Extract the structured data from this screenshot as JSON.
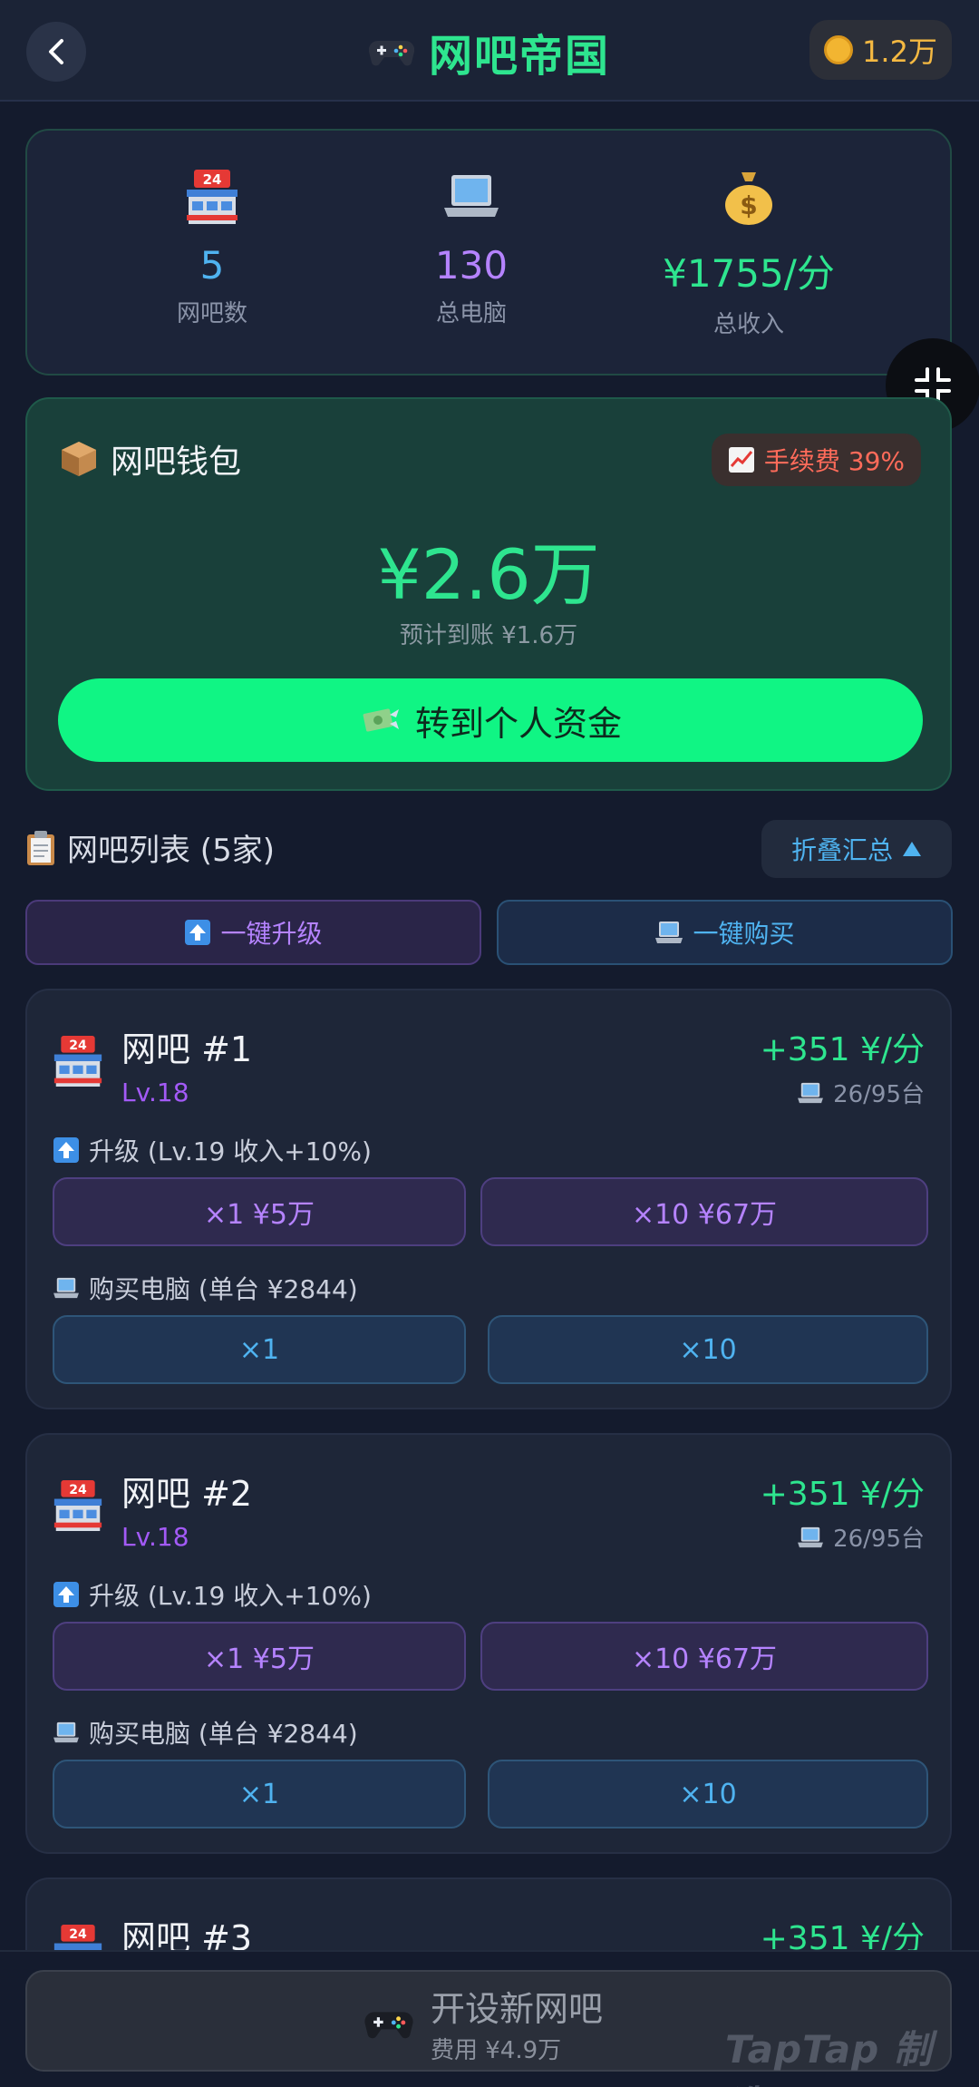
{
  "header": {
    "title": "网吧帝国",
    "coins": "1.2万"
  },
  "stats": [
    {
      "value": "5",
      "label": "网吧数",
      "color": "#4fb3f0"
    },
    {
      "value": "130",
      "label": "总电脑",
      "color": "#b583ff"
    },
    {
      "value": "¥1755/分",
      "label": "总收入",
      "color": "#2ee58f"
    }
  ],
  "wallet": {
    "title": "网吧钱包",
    "fee": "手续费 39%",
    "amount": "¥2.6万",
    "expected": "预计到账 ¥1.6万",
    "transfer_label": "转到个人资金"
  },
  "list": {
    "title": "网吧列表 (5家)",
    "collapse_label": "折叠汇总",
    "upgrade_all": "一键升级",
    "buy_all": "一键购买"
  },
  "cafes": [
    {
      "name": "网吧 #1",
      "level": "Lv.18",
      "income": "+351 ¥/分",
      "pcs": "26/95台",
      "upgrade_label": "升级 (Lv.19 收入+10%)",
      "upgrade_x1": "×1  ¥5万",
      "upgrade_x10": "×10  ¥67万",
      "buy_label": "购买电脑 (单台 ¥2844)",
      "buy_x1": "×1",
      "buy_x10": "×10"
    },
    {
      "name": "网吧 #2",
      "level": "Lv.18",
      "income": "+351 ¥/分",
      "pcs": "26/95台",
      "upgrade_label": "升级 (Lv.19 收入+10%)",
      "upgrade_x1": "×1  ¥5万",
      "upgrade_x10": "×10  ¥67万",
      "buy_label": "购买电脑 (单台 ¥2844)",
      "buy_x1": "×1",
      "buy_x10": "×10"
    },
    {
      "name": "网吧 #3",
      "income": "+351 ¥/分"
    }
  ],
  "bottom": {
    "title": "开设新网吧",
    "cost": "费用 ¥4.9万",
    "watermark": "TapTap 制造"
  }
}
